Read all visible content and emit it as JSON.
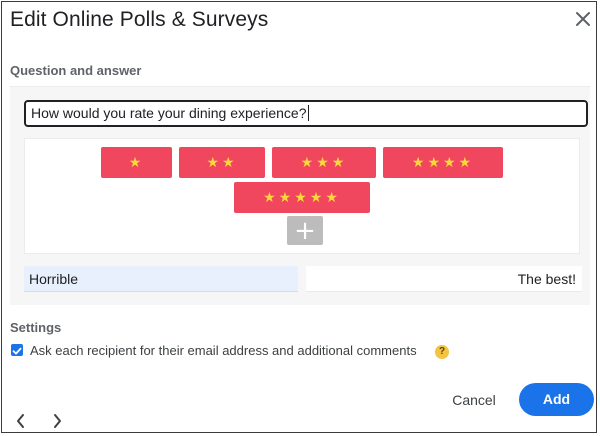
{
  "dialog": {
    "title": "Edit Online Polls & Surveys"
  },
  "question_section": {
    "heading": "Question and answer",
    "question_text": "How would you rate your dining experience?",
    "options": [
      {
        "stars": "★",
        "rating": 1
      },
      {
        "stars": "★★",
        "rating": 2
      },
      {
        "stars": "★★★",
        "rating": 3
      },
      {
        "stars": "★★★★",
        "rating": 4
      },
      {
        "stars": "★★★★★",
        "rating": 5
      }
    ],
    "add_option_symbol": "+",
    "low_label": "Horrible",
    "high_label": "The best!"
  },
  "settings": {
    "heading": "Settings",
    "collect_email_label": "Ask each recipient for their email address and additional comments",
    "collect_email_checked": true,
    "help_symbol": "?"
  },
  "footer": {
    "cancel_label": "Cancel",
    "add_label": "Add"
  },
  "colors": {
    "option_fill": "#f0465e",
    "star": "#f9d83a",
    "primary": "#1a73e8",
    "help_badge": "#f4c342"
  },
  "icons": {
    "close": "close-icon",
    "prev": "chevron-left-icon",
    "next": "chevron-right-icon",
    "check": "checkmark-icon"
  }
}
